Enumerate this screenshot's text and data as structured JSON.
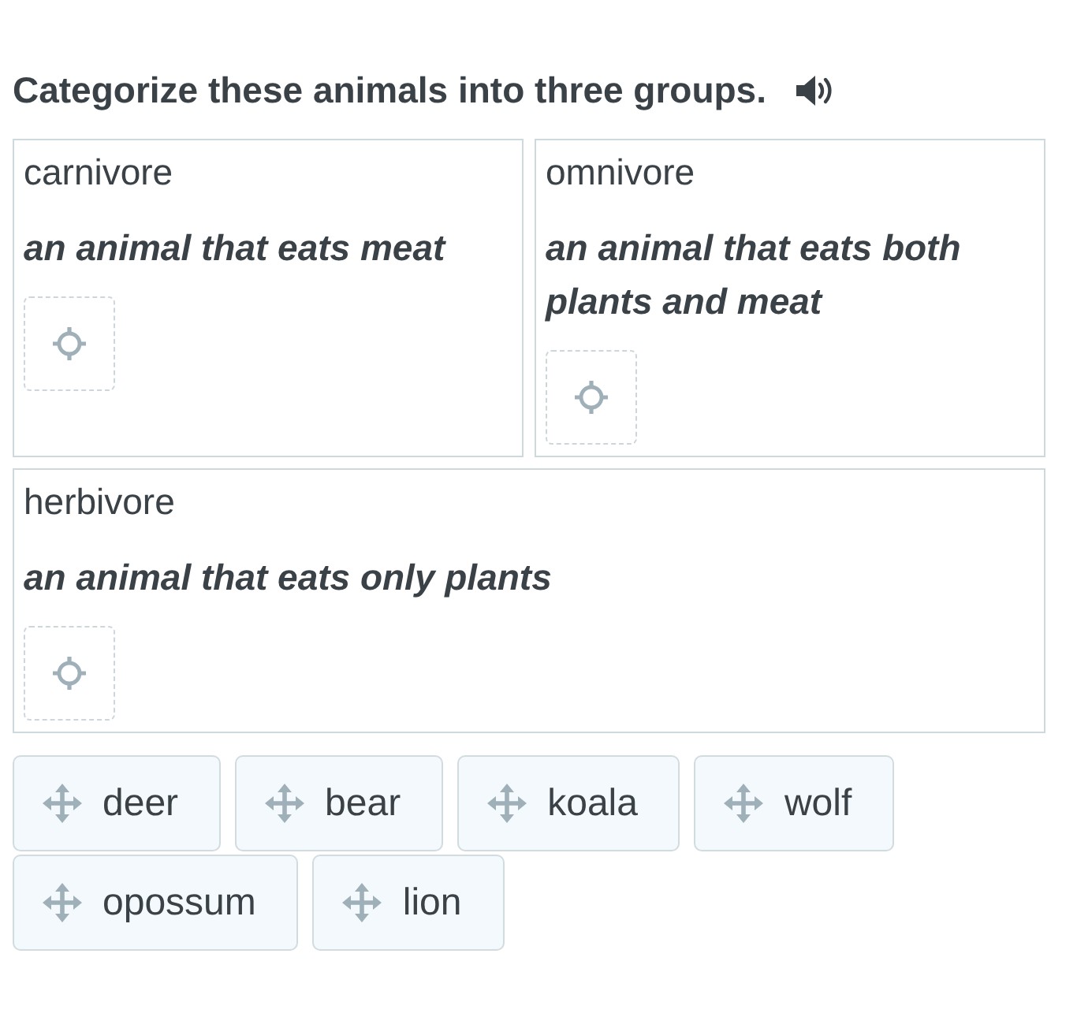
{
  "instruction": {
    "text": "Categorize these animals into three groups."
  },
  "categories": [
    {
      "name": "carnivore",
      "definition": "an animal that eats meat"
    },
    {
      "name": "omnivore",
      "definition": "an animal that eats both plants and meat"
    },
    {
      "name": "herbivore",
      "definition": "an animal that eats only plants"
    }
  ],
  "answer_chips": [
    {
      "label": "deer"
    },
    {
      "label": "bear"
    },
    {
      "label": "koala"
    },
    {
      "label": "wolf"
    },
    {
      "label": "opossum"
    },
    {
      "label": "lion"
    }
  ]
}
